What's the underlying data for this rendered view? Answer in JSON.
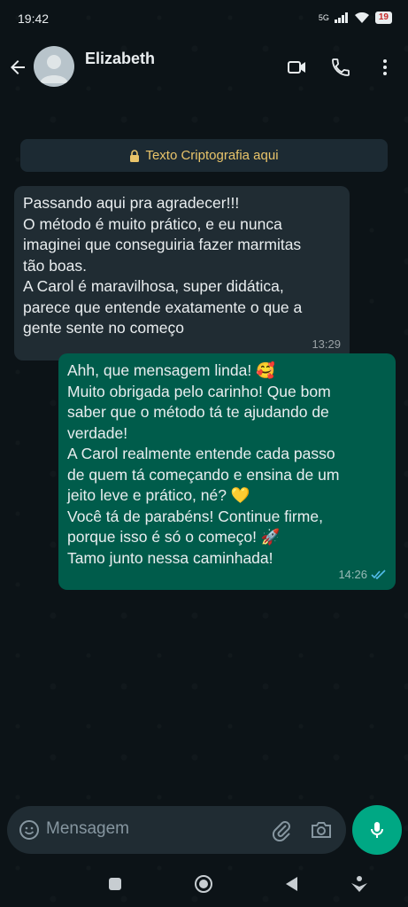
{
  "status_bar": {
    "time": "19:42",
    "network": "5G",
    "battery": "19"
  },
  "header": {
    "contact_name": "Elizabeth"
  },
  "encryption_notice": "Texto Criptografia aqui",
  "messages": {
    "incoming": {
      "lines": [
        "Passando aqui pra agradecer!!!",
        "O método é muito prático, e eu nunca",
        "imaginei que conseguiria fazer marmitas",
        "tão boas.",
        "A Carol é maravilhosa, super didática,",
        "parece que entende exatamente o que a",
        "gente sente no começo"
      ],
      "time": "13:29"
    },
    "outgoing": {
      "lines": [
        "Ahh, que mensagem linda! 🥰",
        "Muito obrigada pelo carinho! Que bom",
        "saber que o método tá te ajudando de",
        "verdade!",
        "A Carol realmente entende cada passo",
        "de quem tá começando e ensina de um",
        "jeito leve e prático, né? 💛",
        "Você tá de parabéns! Continue firme,",
        "porque isso é só o começo! 🚀",
        "Tamo junto nessa caminhada!"
      ],
      "time": "14:26",
      "status": "read"
    }
  },
  "input": {
    "placeholder": "Mensagem"
  },
  "colors": {
    "incoming_bubble": "#202c33",
    "outgoing_bubble": "#005c4b",
    "accent": "#00a884",
    "read_ticks": "#53bdeb"
  }
}
